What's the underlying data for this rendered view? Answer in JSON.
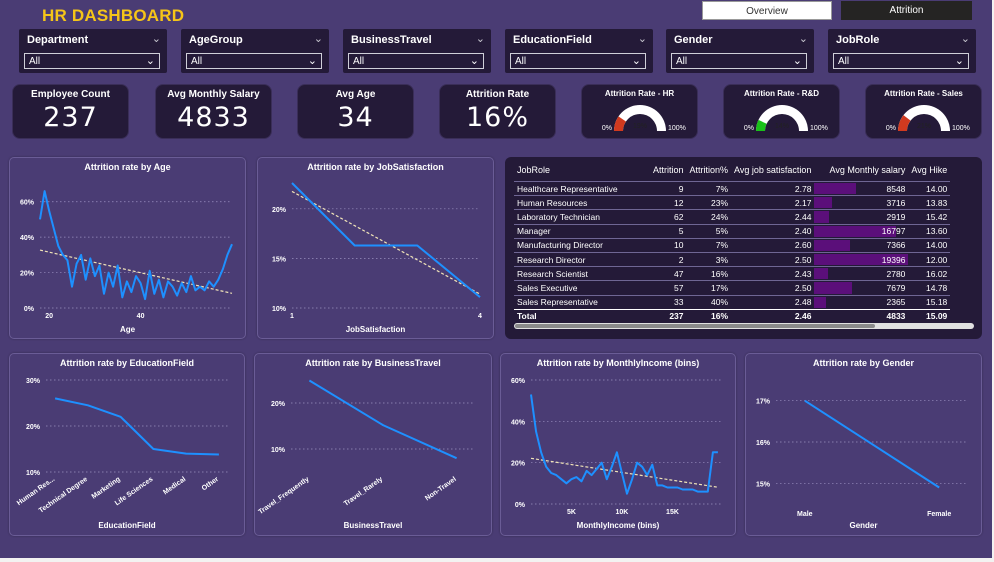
{
  "title": "HR DASHBOARD",
  "nav": {
    "overview": "Overview",
    "attrition": "Attrition"
  },
  "slicers": [
    {
      "label": "Department",
      "value": "All"
    },
    {
      "label": "AgeGroup",
      "value": "All"
    },
    {
      "label": "BusinessTravel",
      "value": "All"
    },
    {
      "label": "EducationField",
      "value": "All"
    },
    {
      "label": "Gender",
      "value": "All"
    },
    {
      "label": "JobRole",
      "value": "All"
    }
  ],
  "kpis": [
    {
      "label": "Employee Count",
      "value": "237"
    },
    {
      "label": "Avg Monthly Salary",
      "value": "4833"
    },
    {
      "label": "Avg Age",
      "value": "34"
    },
    {
      "label": "Attrition Rate",
      "value": "16%"
    }
  ],
  "gauges": [
    {
      "title": "Attrition Rate - HR",
      "value_label": "19%",
      "value": 0.19,
      "min_label": "0%",
      "max_label": "100%",
      "color": "#d13a1f"
    },
    {
      "title": "Attrition Rate - R&D",
      "value_label": "14%",
      "value": 0.14,
      "min_label": "0%",
      "max_label": "100%",
      "color": "#19c119"
    },
    {
      "title": "Attrition Rate - Sales",
      "value_label": "21%",
      "value": 0.21,
      "min_label": "0%",
      "max_label": "100%",
      "color": "#d13a1f"
    }
  ],
  "colors": {
    "line": "#1e90ff",
    "trend": "#f1e4b8",
    "accent": "#f5c518",
    "bar": "#5b0f7a"
  },
  "table": {
    "headers": [
      "JobRole",
      "Attrition",
      "Attrition%",
      "Avg job satisfaction",
      "Avg Monthly salary",
      "Avg Hike"
    ],
    "rows": [
      [
        "Healthcare Representative",
        "9",
        "7%",
        "2.78",
        "8548",
        "14.00"
      ],
      [
        "Human Resources",
        "12",
        "23%",
        "2.17",
        "3716",
        "13.83"
      ],
      [
        "Laboratory Technician",
        "62",
        "24%",
        "2.44",
        "2919",
        "15.42"
      ],
      [
        "Manager",
        "5",
        "5%",
        "2.40",
        "16797",
        "13.60"
      ],
      [
        "Manufacturing Director",
        "10",
        "7%",
        "2.60",
        "7366",
        "14.00"
      ],
      [
        "Research Director",
        "2",
        "3%",
        "2.50",
        "19396",
        "12.00"
      ],
      [
        "Research Scientist",
        "47",
        "16%",
        "2.43",
        "2780",
        "16.02"
      ],
      [
        "Sales Executive",
        "57",
        "17%",
        "2.50",
        "7679",
        "14.78"
      ],
      [
        "Sales Representative",
        "33",
        "40%",
        "2.48",
        "2365",
        "15.18"
      ]
    ],
    "total": [
      "Total",
      "237",
      "16%",
      "2.46",
      "4833",
      "15.09"
    ]
  },
  "chart_data": [
    {
      "id": "age",
      "type": "line",
      "title": "Attrition rate by Age",
      "xlabel": "Age",
      "ylabel": "",
      "xlim": [
        18,
        60
      ],
      "ylim": [
        0,
        70
      ],
      "x_ticks": [
        20,
        40
      ],
      "y_ticks": [
        0,
        20,
        40,
        60
      ],
      "y_format": "percent",
      "trend": true,
      "x": [
        18,
        19,
        20,
        21,
        22,
        23,
        24,
        25,
        26,
        27,
        28,
        29,
        30,
        31,
        32,
        33,
        34,
        35,
        36,
        37,
        38,
        39,
        40,
        41,
        42,
        43,
        44,
        45,
        46,
        47,
        48,
        49,
        50,
        51,
        52,
        53,
        54,
        55,
        56,
        57,
        58,
        59,
        60
      ],
      "values": [
        50,
        66,
        55,
        45,
        35,
        30,
        27,
        12,
        25,
        30,
        16,
        28,
        18,
        24,
        8,
        20,
        12,
        24,
        6,
        15,
        9,
        18,
        14,
        5,
        21,
        8,
        16,
        6,
        15,
        12,
        7,
        14,
        9,
        18,
        10,
        12,
        10,
        15,
        12,
        16,
        22,
        30,
        36
      ]
    },
    {
      "id": "jobsat",
      "type": "line",
      "title": "Attrition rate by JobSatisfaction",
      "xlabel": "JobSatisfaction",
      "ylabel": "",
      "xlim": [
        1,
        4
      ],
      "ylim": [
        10,
        22.5
      ],
      "x_ticks": [
        1,
        4
      ],
      "y_ticks": [
        10,
        15,
        20
      ],
      "y_format": "percent",
      "trend": true,
      "x": [
        1,
        2,
        3,
        4
      ],
      "values": [
        22.6,
        16.3,
        16.3,
        11.1
      ]
    },
    {
      "id": "edu",
      "type": "line",
      "title": "Attrition rate by EducationField",
      "xlabel": "EducationField",
      "ylabel": "",
      "ylim": [
        10,
        30
      ],
      "y_ticks": [
        10,
        20,
        30
      ],
      "y_format": "percent",
      "trend": false,
      "categories": [
        "Human Res...",
        "Technical Degree",
        "Marketing",
        "Life Sciences",
        "Medical",
        "Other"
      ],
      "values": [
        26,
        24.5,
        22,
        15,
        14,
        13.8
      ]
    },
    {
      "id": "travel",
      "type": "line",
      "title": "Attrition rate by BusinessTravel",
      "xlabel": "BusinessTravel",
      "ylabel": "",
      "ylim": [
        5,
        25
      ],
      "y_ticks": [
        10,
        20
      ],
      "y_format": "percent",
      "trend": false,
      "categories": [
        "Travel_Frequently",
        "Travel_Rarely",
        "Non-Travel"
      ],
      "values": [
        24.9,
        15.2,
        8.0
      ]
    },
    {
      "id": "income",
      "type": "line",
      "title": "Attrition rate by MonthlyIncome (bins)",
      "xlabel": "MonthlyIncome (bins)",
      "ylabel": "",
      "xlim": [
        1000,
        20000
      ],
      "ylim": [
        0,
        60
      ],
      "x_ticks": [
        5000,
        10000,
        15000
      ],
      "x_tick_labels": [
        "5K",
        "10K",
        "15K"
      ],
      "y_ticks": [
        0,
        20,
        40,
        60
      ],
      "y_format": "percent",
      "trend": true,
      "x": [
        1000,
        1500,
        2000,
        2500,
        3000,
        3500,
        4000,
        4500,
        5000,
        5500,
        6000,
        6500,
        7000,
        7500,
        8000,
        8500,
        9000,
        9500,
        10000,
        10500,
        11000,
        11500,
        12000,
        12500,
        13000,
        13500,
        14000,
        14500,
        15000,
        15500,
        16000,
        16500,
        17000,
        17500,
        18000,
        18500,
        19000,
        19500
      ],
      "values": [
        53,
        35,
        25,
        18,
        15,
        14,
        12,
        10,
        12,
        13,
        11,
        16,
        14,
        17,
        20,
        12,
        18,
        25,
        15,
        5,
        12,
        20,
        18,
        14,
        19,
        9,
        9,
        8,
        8,
        8,
        7,
        7,
        7,
        6,
        6,
        6,
        25,
        25
      ]
    },
    {
      "id": "gender",
      "type": "line",
      "title": "Attrition rate by Gender",
      "xlabel": "Gender",
      "ylabel": "",
      "ylim": [
        14.5,
        17.5
      ],
      "y_ticks": [
        15,
        16,
        17
      ],
      "y_format": "percent",
      "trend": false,
      "categories": [
        "Male",
        "Female"
      ],
      "values": [
        17.0,
        14.9
      ]
    }
  ]
}
